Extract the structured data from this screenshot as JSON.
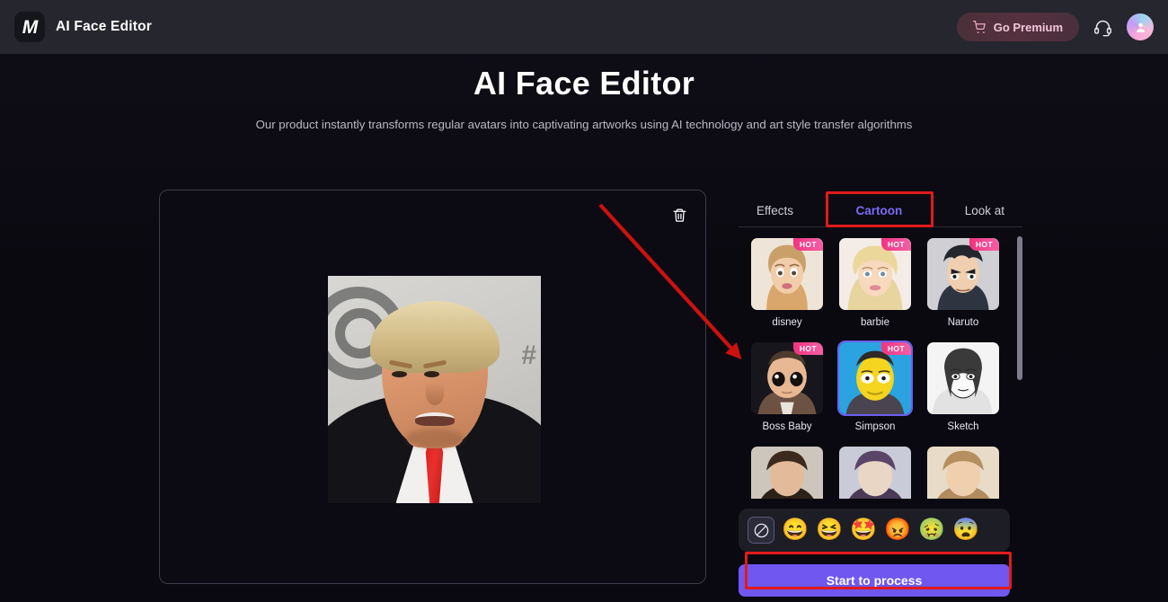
{
  "header": {
    "logo_icon": "app-logo-icon",
    "brand_title": "AI Face Editor",
    "premium_label": "Go Premium",
    "cart_icon": "shopping-cart-icon",
    "support_icon": "headset-icon",
    "avatar_icon": "user-avatar-icon"
  },
  "hero": {
    "title": "AI Face Editor",
    "subtitle": "Our product instantly transforms regular avatars into captivating artworks using AI technology and art style transfer algorithms"
  },
  "canvas": {
    "delete_icon": "trash-icon",
    "photo_alt": "uploaded-portrait-photo"
  },
  "panel": {
    "tabs": [
      {
        "label": "Effects",
        "active": false
      },
      {
        "label": "Cartoon",
        "active": true
      },
      {
        "label": "Look at",
        "active": false
      }
    ],
    "styles": [
      {
        "label": "disney",
        "hot": true,
        "selected": false
      },
      {
        "label": "barbie",
        "hot": true,
        "selected": false
      },
      {
        "label": "Naruto",
        "hot": true,
        "selected": false
      },
      {
        "label": "Boss Baby",
        "hot": true,
        "selected": false
      },
      {
        "label": "Simpson",
        "hot": true,
        "selected": true
      },
      {
        "label": "Sketch",
        "hot": false,
        "selected": false
      },
      {
        "label": "",
        "hot": false,
        "selected": false
      },
      {
        "label": "",
        "hot": false,
        "selected": false
      },
      {
        "label": "",
        "hot": false,
        "selected": false
      }
    ],
    "hot_badge_text": "HOT",
    "emojis": [
      {
        "name": "no-expression-icon",
        "glyph": "",
        "selected": true
      },
      {
        "name": "grinning-face-emoji",
        "glyph": "😄",
        "selected": false
      },
      {
        "name": "laughing-crying-face-emoji",
        "glyph": "😆",
        "selected": false
      },
      {
        "name": "excited-face-emoji",
        "glyph": "🤩",
        "selected": false
      },
      {
        "name": "angry-face-emoji",
        "glyph": "😡",
        "selected": false
      },
      {
        "name": "nauseated-face-emoji",
        "glyph": "🤢",
        "selected": false
      },
      {
        "name": "shocked-face-emoji",
        "glyph": "😨",
        "selected": false
      }
    ],
    "process_label": "Start to process"
  },
  "colors": {
    "accent_purple": "#6f57f0",
    "tab_active": "#7a6bf5",
    "hot_badge": "#f2337f",
    "annotation_red": "#e01b1b",
    "header_bg": "#26262e",
    "page_bg": "#0b0910"
  }
}
